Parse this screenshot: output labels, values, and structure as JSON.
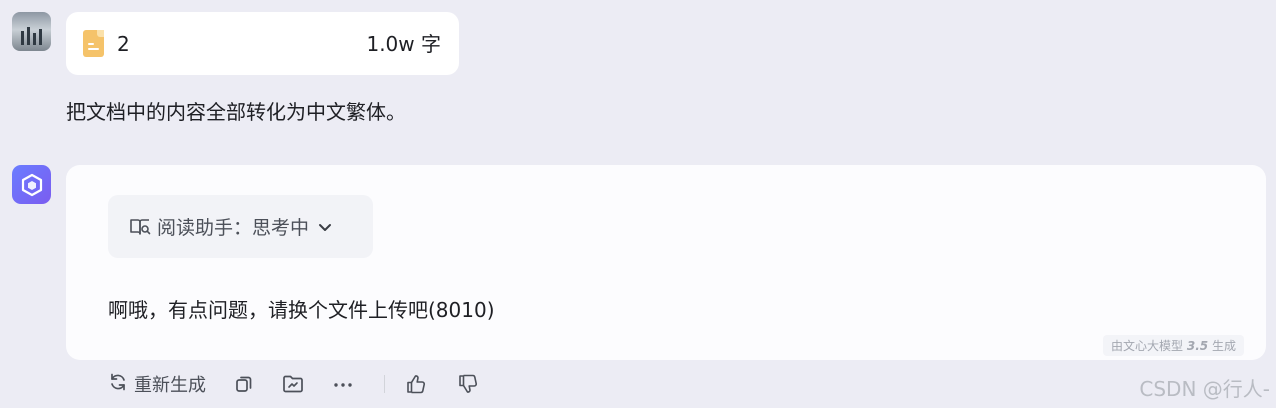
{
  "user": {
    "file": {
      "name": "2",
      "size": "1.0w 字"
    },
    "message": "把文档中的内容全部转化为中文繁体。"
  },
  "bot": {
    "reader_chip": {
      "label": "阅读助手：思考中"
    },
    "answer": "啊哦，有点问题，请换个文件上传吧(8010)",
    "model_tag": {
      "prefix": "由文心大模型",
      "version": "3.5",
      "suffix": "生成"
    }
  },
  "actions": {
    "regenerate_label": "重新生成"
  },
  "watermark": "CSDN @行人-",
  "colors": {
    "page_bg": "#ececf4",
    "card_bg": "#ffffff",
    "file_icon": "#f5c36a",
    "bot_avatar": "#6a7dff"
  },
  "icons": {
    "file": "document-file-icon",
    "reader": "book-search-icon",
    "chevron": "chevron-down-icon",
    "regenerate": "refresh-icon",
    "copy": "copy-icon",
    "share": "export-icon",
    "more": "more-dots-icon",
    "like": "thumbs-up-icon",
    "dislike": "thumbs-down-icon"
  }
}
